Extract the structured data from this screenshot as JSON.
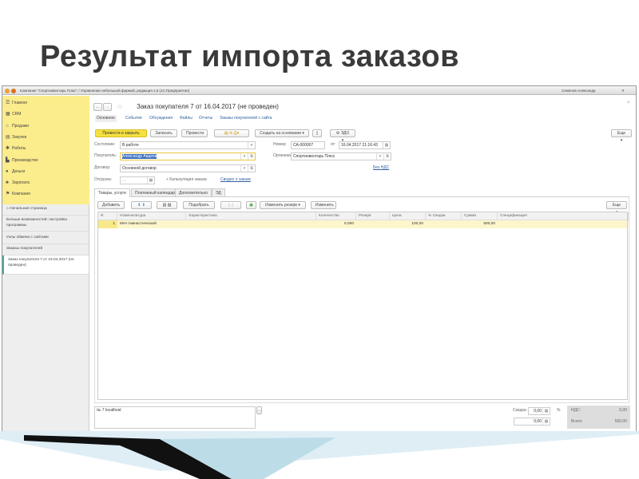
{
  "slide_title": "Результат импорта заказов",
  "window": {
    "title": "Компания \"Спортинвентарь Плюс\" / Управление небольшой фирмой, редакция 1.6 (1С:Предприятие)",
    "user": "Семенов Александр"
  },
  "sidebar": {
    "items": [
      {
        "icon": "menu-icon",
        "glyph": "☰",
        "label": "Главное"
      },
      {
        "icon": "crm-icon",
        "glyph": "▦",
        "label": "CRM"
      },
      {
        "icon": "sales-icon",
        "glyph": "⌂",
        "label": "Продажи"
      },
      {
        "icon": "purchases-icon",
        "glyph": "▤",
        "label": "Закупки"
      },
      {
        "icon": "works-icon",
        "glyph": "✱",
        "label": "Работы"
      },
      {
        "icon": "production-icon",
        "glyph": "▙",
        "label": "Производство"
      },
      {
        "icon": "money-icon",
        "glyph": "●",
        "label": "Деньги"
      },
      {
        "icon": "salary-icon",
        "glyph": "♣",
        "label": "Зарплата"
      },
      {
        "icon": "company-icon",
        "glyph": "⚑",
        "label": "Компания"
      }
    ],
    "open": [
      {
        "label": "Начальная страница"
      },
      {
        "label": "Больше возможностей: настройка программы"
      },
      {
        "label": "Узлы обмена с сайтами"
      },
      {
        "label": "Заказы покупателей"
      },
      {
        "label": "Заказ покупателя 7 от 16.04.2017 (не проведен)"
      }
    ]
  },
  "doc": {
    "title": "Заказ покупателя 7 от 16.04.2017 (не проведен)",
    "nav": [
      "Основное",
      "События",
      "Обсуждения",
      "Файлы",
      "Отчеты",
      "Заказы покупателей с сайта"
    ],
    "toolbar": {
      "post_close": "Провести и закрыть",
      "save": "Записать",
      "post": "Провести",
      "create_based": "Создать на основании",
      "edo": "ЭДО",
      "more": "Еще"
    },
    "fields": {
      "state_label": "Состояние:",
      "state": "В работе",
      "buyer_label": "Покупатель:",
      "buyer": "Александр Авдеев",
      "contract_label": "Договор:",
      "contract": "Основной договор",
      "ship_label": "Отгрузка:",
      "ship": ". .",
      "calc": "+ Калькуляция заказа",
      "summary": "Сводно о заказе",
      "number_label": "Номер:",
      "number": "СА-000007",
      "date_label": "от:",
      "date": "16.04.2017 21:16:43",
      "org_label": "Организация:",
      "org": "Спортинвентарь Плюс",
      "vat_link": "Без НДС"
    },
    "tabs": [
      "Товары, услуги",
      "Платежный календарь",
      "Дополнительно",
      "ЭД"
    ],
    "table_toolbar": {
      "add": "Добавить",
      "pick": "Подобрать",
      "reserve": "Изменить резерв",
      "change": "Изменить",
      "more": "Еще"
    },
    "columns": [
      "N",
      "Номенклатура",
      "Характеристика",
      "Количество",
      "Резерв",
      "Цена",
      "% Скидки",
      "Сумма",
      "Спецификация"
    ],
    "rows": [
      {
        "n": "1",
        "item": "Мяч гимнастический",
        "char": "",
        "qty": "5,000",
        "reserve": "",
        "price": "100,00",
        "disc": "",
        "sum": "500,00",
        "spec": ""
      }
    ],
    "comment": "№ 7 localhost",
    "totals": {
      "discount_label": "Скидка:",
      "discount_pct": "0,00",
      "pct_sign": "%",
      "discount_sum": "0,00",
      "vat_label": "НДС:",
      "vat": "0,00",
      "total_label": "Всего:",
      "total": "500,00"
    }
  }
}
